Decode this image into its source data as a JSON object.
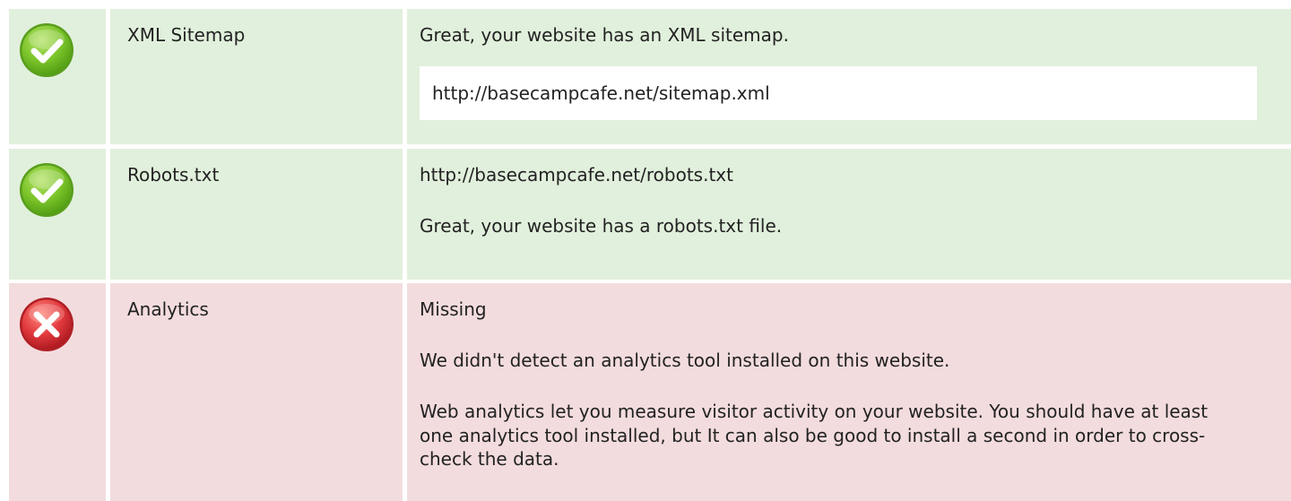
{
  "checks": [
    {
      "key": "sitemap",
      "status": "pass",
      "status_icon": "check-circle-icon",
      "name": "XML Sitemap",
      "message": "Great, your website has an XML sitemap.",
      "url": "http://basecampcafe.net/sitemap.xml"
    },
    {
      "key": "robots",
      "status": "pass",
      "status_icon": "check-circle-icon",
      "name": "Robots.txt",
      "url": "http://basecampcafe.net/robots.txt",
      "message": "Great, your website has a robots.txt file."
    },
    {
      "key": "analytics",
      "status": "fail",
      "status_icon": "cross-circle-icon",
      "name": "Analytics",
      "value": "Missing",
      "message": "We didn't detect an analytics tool installed on this website.",
      "description": "Web analytics let you measure visitor activity on your website. You should have at least one analytics tool installed, but It can also be good to install a second in order to cross-check the data."
    }
  ],
  "colors": {
    "pass_background": "#e1f0dc",
    "fail_background": "#f3dcde",
    "pass_icon": "#7cc42a",
    "fail_icon": "#e23a3e",
    "text": "#222222"
  }
}
